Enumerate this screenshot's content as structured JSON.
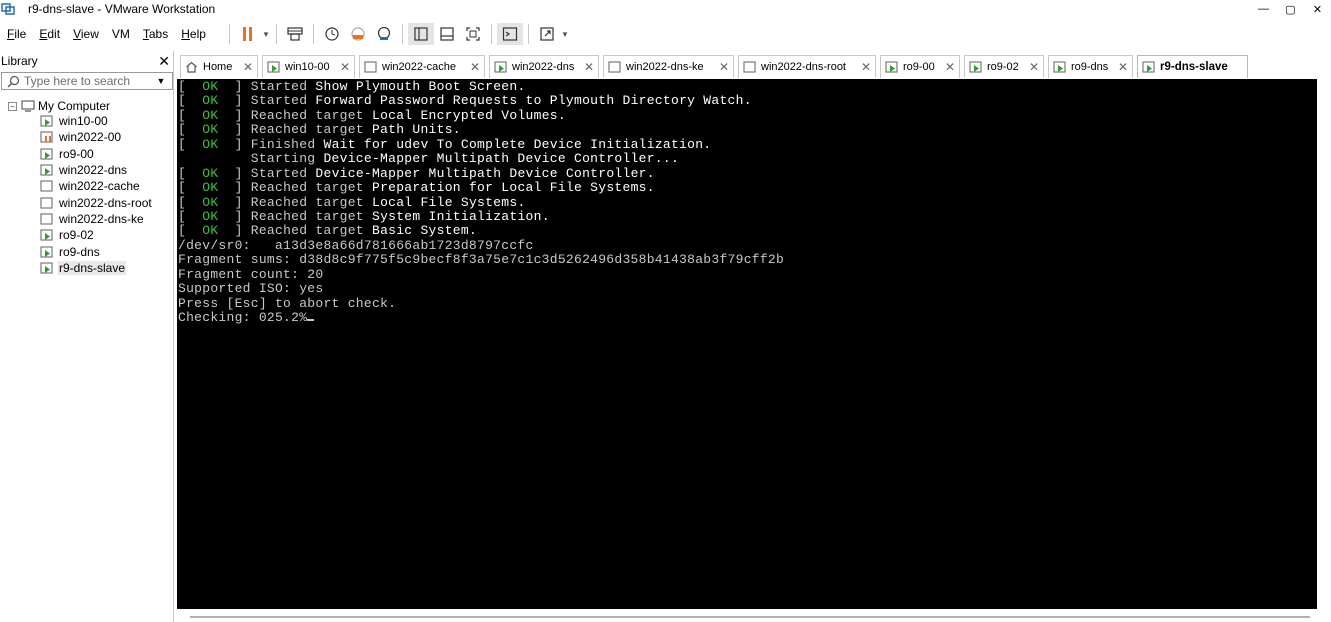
{
  "window": {
    "title": "r9-dns-slave - VMware Workstation",
    "controls": {
      "minimize": "—",
      "maximize": "▢",
      "close": "✕"
    }
  },
  "menu": [
    {
      "label": "File",
      "underline": "F",
      "rest": "ile"
    },
    {
      "label": "Edit",
      "underline": "E",
      "rest": "dit"
    },
    {
      "label": "View",
      "underline": "V",
      "rest": "iew"
    },
    {
      "label": "VM",
      "underline": "",
      "rest": "VM"
    },
    {
      "label": "Tabs",
      "underline": "T",
      "rest": "abs"
    },
    {
      "label": "Help",
      "underline": "H",
      "rest": "elp"
    }
  ],
  "toolbar": {
    "icons": [
      "pause-icon",
      "send-ctrl-alt-del-icon",
      "snapshot-icon",
      "revert-snapshot-icon",
      "snapshot-manager-icon",
      "show-library-icon",
      "thumbnail-bar-icon",
      "full-screen-icon",
      "console-view-icon",
      "stretch-guest-icon"
    ],
    "accent": "#e8702a"
  },
  "library": {
    "title": "Library",
    "close": "✕",
    "search": {
      "placeholder": "Type here to search",
      "value": ""
    },
    "root": "My Computer",
    "vms": [
      {
        "name": "win10-00",
        "state": "running"
      },
      {
        "name": "win2022-00",
        "state": "paused"
      },
      {
        "name": "ro9-00",
        "state": "running"
      },
      {
        "name": "win2022-dns",
        "state": "running"
      },
      {
        "name": "win2022-cache",
        "state": "off"
      },
      {
        "name": "win2022-dns-root",
        "state": "off"
      },
      {
        "name": "win2022-dns-ke",
        "state": "off"
      },
      {
        "name": "ro9-02",
        "state": "running"
      },
      {
        "name": "ro9-dns",
        "state": "running"
      },
      {
        "name": "r9-dns-slave",
        "state": "running",
        "selected": true
      }
    ]
  },
  "tabs": [
    {
      "label": "Home",
      "icon": "home-icon",
      "width": 78
    },
    {
      "label": "win10-00",
      "icon": "vm-running-icon",
      "width": 93
    },
    {
      "label": "win2022-cache",
      "icon": "vm-off-icon",
      "width": 126
    },
    {
      "label": "win2022-dns",
      "icon": "vm-running-icon",
      "width": 110
    },
    {
      "label": "win2022-dns-ke",
      "icon": "vm-off-icon",
      "width": 131
    },
    {
      "label": "win2022-dns-root",
      "icon": "vm-off-icon",
      "width": 138
    },
    {
      "label": "ro9-00",
      "icon": "vm-running-icon",
      "width": 80
    },
    {
      "label": "ro9-02",
      "icon": "vm-running-icon",
      "width": 80
    },
    {
      "label": "ro9-dns",
      "icon": "vm-running-icon",
      "width": 85
    },
    {
      "label": "r9-dns-slave",
      "icon": "vm-running-icon",
      "width": 111,
      "active": true
    }
  ],
  "console": {
    "lines": [
      {
        "prefix": "[  ",
        "ok": "OK",
        "suffix": "  ] ",
        "verb": "Started ",
        "text": "Show Plymouth Boot Screen."
      },
      {
        "prefix": "[  ",
        "ok": "OK",
        "suffix": "  ] ",
        "verb": "Started ",
        "text": "Forward Password Requests to Plymouth Directory Watch."
      },
      {
        "prefix": "[  ",
        "ok": "OK",
        "suffix": "  ] ",
        "verb": "Reached target ",
        "text": "Local Encrypted Volumes."
      },
      {
        "prefix": "[  ",
        "ok": "OK",
        "suffix": "  ] ",
        "verb": "Reached target ",
        "text": "Path Units."
      },
      {
        "prefix": "[  ",
        "ok": "OK",
        "suffix": "  ] ",
        "verb": "Finished ",
        "text": "Wait for udev To Complete Device Initialization."
      },
      {
        "prefix": "         ",
        "ok": "",
        "suffix": "",
        "verb": "Starting ",
        "text": "Device-Mapper Multipath Device Controller..."
      },
      {
        "prefix": "[  ",
        "ok": "OK",
        "suffix": "  ] ",
        "verb": "Started ",
        "text": "Device-Mapper Multipath Device Controller."
      },
      {
        "prefix": "[  ",
        "ok": "OK",
        "suffix": "  ] ",
        "verb": "Reached target ",
        "text": "Preparation for Local File Systems."
      },
      {
        "prefix": "[  ",
        "ok": "OK",
        "suffix": "  ] ",
        "verb": "Reached target ",
        "text": "Local File Systems."
      },
      {
        "prefix": "[  ",
        "ok": "OK",
        "suffix": "  ] ",
        "verb": "Reached target ",
        "text": "System Initialization."
      },
      {
        "prefix": "[  ",
        "ok": "OK",
        "suffix": "  ] ",
        "verb": "Reached target ",
        "text": "Basic System."
      },
      {
        "plain": "/dev/sr0:   a13d3e8a66d781666ab1723d8797ccfc"
      },
      {
        "plain": "Fragment sums: d38d8c9f775f5c9becf8f3a75e7c1c3d5262496d358b41438ab3f79cff2b"
      },
      {
        "plain": "Fragment count: 20"
      },
      {
        "plain": "Supported ISO: yes"
      },
      {
        "plain": "Press [Esc] to abort check."
      },
      {
        "plain": "Checking: 025.2%",
        "cursor": true
      }
    ],
    "colors": {
      "background": "#000000",
      "ok": "#3fbf3f",
      "text": "#c9c9c9",
      "bright": "#ffffff"
    }
  }
}
